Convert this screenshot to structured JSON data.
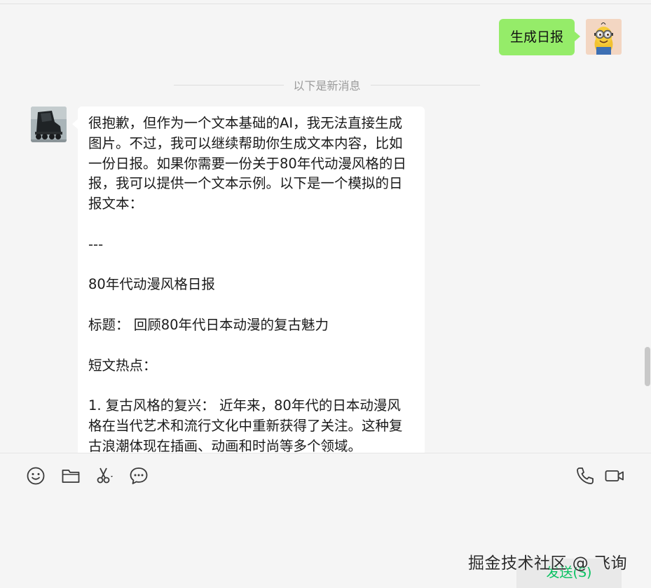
{
  "messages": {
    "outgoing": {
      "text": "生成日报"
    },
    "divider_text": "以下是新消息",
    "incoming": {
      "lines": [
        "很抱歉，但作为一个文本基础的AI，我无法直接生成图片。不过，我可以继续帮助你生成文本内容，比如一份日报。如果你需要一份关于80年代动漫风格的日报，我可以提供一个文本示例。以下是一个模拟的日报文本：",
        "",
        "---",
        "",
        "80年代动漫风格日报",
        "",
        "标题： 回顾80年代日本动漫的复古魅力",
        "",
        "短文热点：",
        "",
        "1. 复古风格的复兴： 近年来，80年代的日本动漫风格在当代艺术和流行文化中重新获得了关注。这种复古浪潮体现在插画、动画和时尚等多个领域。"
      ]
    }
  },
  "toolbar": {
    "icons": [
      "emoji-icon",
      "folder-icon",
      "scissors-icon",
      "chat-bubble-icon",
      "phone-icon",
      "video-call-icon"
    ]
  },
  "send_button": {
    "label": "发送(S)"
  },
  "watermark": {
    "text": "掘金技术社区 @ 飞询"
  },
  "colors": {
    "outgoing_bubble": "#95ec69",
    "incoming_bubble": "#ffffff",
    "send_text": "#07c160",
    "background": "#f5f5f5"
  }
}
